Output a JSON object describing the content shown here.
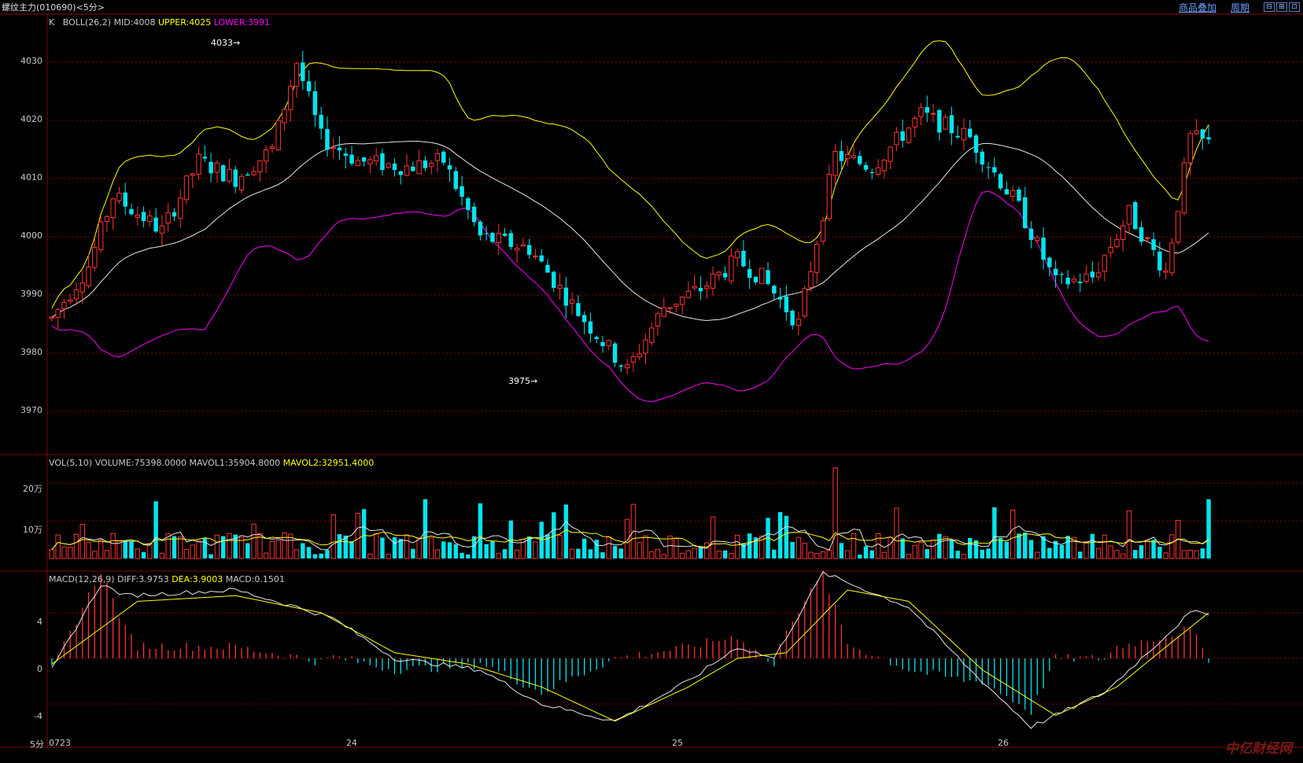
{
  "window": {
    "title": "螺纹主力",
    "code": "(010690)",
    "period": "<5分>",
    "links": [
      "商品叠加",
      "周期"
    ],
    "buttons": [
      "⊟",
      "⊞",
      "⊡"
    ]
  },
  "main_panel": {
    "label_k": "K",
    "label_ind": "BOLL(26,2)",
    "mid": "MID:4008",
    "upper": "UPPER:4025",
    "lower": "LOWER:3991",
    "y_ticks": [
      "4030",
      "4020",
      "4010",
      "4000",
      "3990",
      "3980",
      "3970"
    ],
    "high_mark": "4033",
    "low_mark": "3975"
  },
  "vol_panel": {
    "label": "VOL(5,10)",
    "volume": "VOLUME:75398.0000",
    "mavol1": "MAVOL1:35904.8000",
    "mavol2": "MAVOL2:32951.4000",
    "y_ticks": [
      "20万",
      "10万"
    ]
  },
  "macd_panel": {
    "label": "MACD(12,26,9)",
    "diff": "DIFF:3.9753",
    "dea": "DEA:3.9003",
    "macd": "MACD:0.1501",
    "y_ticks": [
      "4",
      "0",
      "-4"
    ]
  },
  "x_axis": {
    "period": "5分",
    "ticks": [
      "0723",
      "24",
      "25",
      "26"
    ]
  },
  "watermark": "中亿财经网",
  "colors": {
    "up": "#ff3333",
    "down": "#00e5ee",
    "mid": "#e6e6e6",
    "upper": "#ffff00",
    "lower": "#ff00ff",
    "grid": "#8a0000"
  },
  "chart_data": {
    "type": "candlestick",
    "bars": 190,
    "price_range": [
      3965,
      4034
    ],
    "close_anchors": [
      [
        0,
        3986
      ],
      [
        6,
        3995
      ],
      [
        10,
        4007
      ],
      [
        18,
        4001
      ],
      [
        24,
        4013
      ],
      [
        30,
        4010
      ],
      [
        36,
        4015
      ],
      [
        40,
        4030
      ],
      [
        44,
        4017
      ],
      [
        50,
        4013
      ],
      [
        58,
        4012
      ],
      [
        64,
        4013
      ],
      [
        70,
        4000
      ],
      [
        78,
        3998
      ],
      [
        86,
        3987
      ],
      [
        94,
        3977
      ],
      [
        100,
        3988
      ],
      [
        106,
        3991
      ],
      [
        112,
        3996
      ],
      [
        116,
        3993
      ],
      [
        122,
        3985
      ],
      [
        128,
        4014
      ],
      [
        134,
        4012
      ],
      [
        142,
        4021
      ],
      [
        150,
        4017
      ],
      [
        158,
        4005
      ],
      [
        164,
        3992
      ],
      [
        170,
        3993
      ],
      [
        176,
        4004
      ],
      [
        182,
        3994
      ],
      [
        186,
        4017
      ],
      [
        189,
        4016
      ]
    ],
    "diff_anchors": [
      [
        0,
        -1
      ],
      [
        8,
        6.5
      ],
      [
        12,
        5.5
      ],
      [
        30,
        6
      ],
      [
        40,
        4.5
      ],
      [
        46,
        3.5
      ],
      [
        56,
        0
      ],
      [
        70,
        -1
      ],
      [
        80,
        -4
      ],
      [
        92,
        -5.5
      ],
      [
        104,
        -2
      ],
      [
        112,
        1
      ],
      [
        118,
        0
      ],
      [
        126,
        7.5
      ],
      [
        140,
        4.5
      ],
      [
        150,
        -1
      ],
      [
        160,
        -6
      ],
      [
        172,
        -3
      ],
      [
        178,
        0
      ],
      [
        186,
        4
      ],
      [
        189,
        4
      ]
    ],
    "dea_anchors": [
      [
        0,
        -0.5
      ],
      [
        14,
        5
      ],
      [
        30,
        5.5
      ],
      [
        44,
        4
      ],
      [
        56,
        0.5
      ],
      [
        68,
        -0.5
      ],
      [
        80,
        -2.5
      ],
      [
        92,
        -5.5
      ],
      [
        104,
        -2.5
      ],
      [
        112,
        0
      ],
      [
        120,
        0.5
      ],
      [
        130,
        6
      ],
      [
        140,
        5
      ],
      [
        152,
        -1
      ],
      [
        164,
        -5
      ],
      [
        174,
        -2.5
      ],
      [
        182,
        1
      ],
      [
        189,
        4
      ]
    ]
  }
}
